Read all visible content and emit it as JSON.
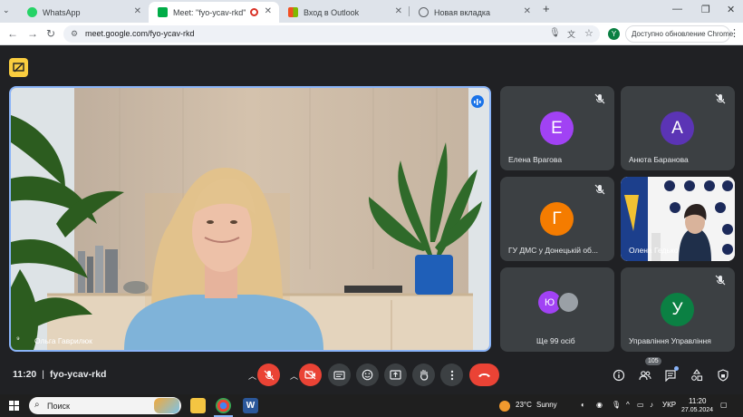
{
  "browser": {
    "tabs": [
      {
        "title": "WhatsApp",
        "favicon_color": "#25d366",
        "active": false
      },
      {
        "title": "Meet: \"fyo-ycav-rkd\"",
        "favicon_color": "#00ac47",
        "active": true
      },
      {
        "title": "Вход в Outlook",
        "favicon_color": "#f25022",
        "active": false
      },
      {
        "title": "Новая вкладка",
        "favicon_color": "#5f6368",
        "active": false
      }
    ],
    "url": "meet.google.com/fyo-ycav-rkd",
    "profile_initial": "Y",
    "update_label": "Доступно обновление Chrome"
  },
  "meet": {
    "main_speaker": {
      "name": "Ольга Гаврилюк"
    },
    "participants": [
      {
        "name": "Елена Врагова",
        "initial": "Е",
        "color": "#a142f4"
      },
      {
        "name": "Анюта Баранова",
        "initial": "А",
        "color": "#5b34b5"
      },
      {
        "name": "ГУ ДМС у Донецькій об...",
        "initial": "Г",
        "color": "#f57c00"
      },
      {
        "name": "Олена Гедько",
        "initial": "",
        "color": "#ffffff"
      },
      {
        "name": "Ще 99 осіб",
        "initial": "Ю",
        "color": "#a142f4"
      },
      {
        "name": "Управління Управління",
        "initial": "У",
        "color": "#0b8043"
      }
    ],
    "time": "11:20",
    "separator": "|",
    "meeting_code": "fyo-ycav-rkd",
    "people_count": "105",
    "accent": "#8ab4f8",
    "danger": "#ea4335"
  },
  "taskbar": {
    "search_label": "Поиск",
    "weather": "23°C",
    "weather_text": "Sunny",
    "language": "УКР",
    "time": "11:20",
    "date": "27.05.2024"
  }
}
